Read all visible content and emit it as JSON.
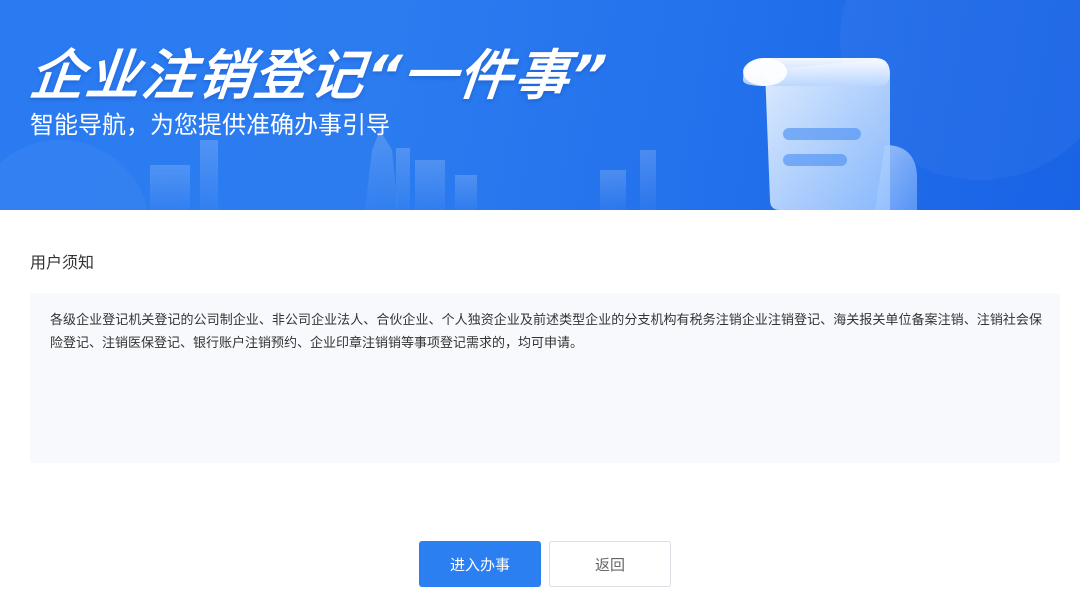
{
  "banner": {
    "title": "企业注销登记“一件事”",
    "subtitle": "智能导航，为您提供准确办事引导",
    "decoration_icon": "document-scroll-icon",
    "gradient_colors": [
      "#2a7bf2",
      "#1963e6"
    ]
  },
  "notice": {
    "section_title": "用户须知",
    "text": "各级企业登记机关登记的公司制企业、非公司企业法人、合伙企业、个人独资企业及前述类型企业的分支机构有税务注销企业注销登记、海关报关单位备案注销、注销社会保险登记、注销医保登记、银行账户注销预约、企业印章注销销等事项登记需求的，均可申请。"
  },
  "actions": {
    "enter_label": "进入办事",
    "back_label": "返回"
  },
  "colors": {
    "primary": "#2b7ff1",
    "notice_background": "#f7f9fc"
  }
}
